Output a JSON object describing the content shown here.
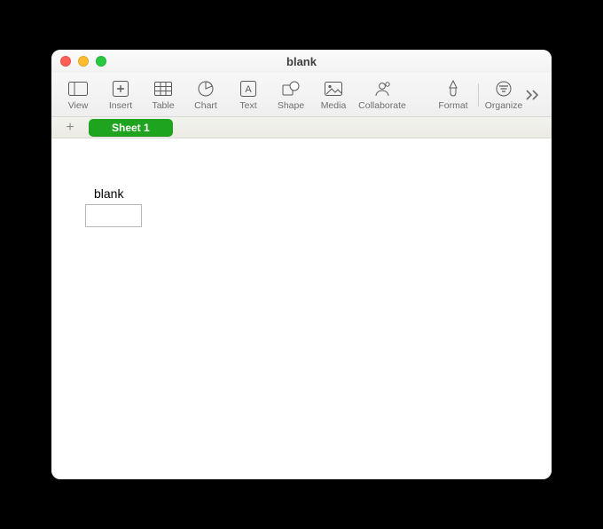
{
  "window": {
    "title": "blank"
  },
  "toolbar": {
    "items": [
      {
        "label": "View"
      },
      {
        "label": "Insert"
      },
      {
        "label": "Table"
      },
      {
        "label": "Chart"
      },
      {
        "label": "Text"
      },
      {
        "label": "Shape"
      },
      {
        "label": "Media"
      },
      {
        "label": "Collaborate"
      }
    ],
    "right": [
      {
        "label": "Format"
      },
      {
        "label": "Organize"
      }
    ]
  },
  "tabs": {
    "active": "Sheet 1"
  },
  "canvas": {
    "table_title": "blank"
  }
}
